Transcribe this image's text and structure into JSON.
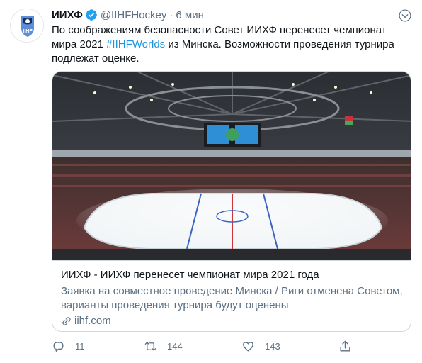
{
  "account": {
    "name": "ИИХФ",
    "handle": "@IIHFHockey",
    "separator": "·",
    "time": "6 мин",
    "logo_text": "IIHF"
  },
  "tweet": {
    "text_part1": "По соображениям безопасности Совет ИИХФ перенесет чемпионат мира 2021 ",
    "hashtag": "#IIHFWorlds",
    "text_part2": " из Минска. Возможности проведения турнира подлежат оценке."
  },
  "card": {
    "title": "ИИХФ - ИИХФ перенесет чемпионат мира 2021 года",
    "description": "Заявка на совместное проведение Минска / Риги отменена Советом, варианты проведения турнира будут оценены",
    "domain": "iihf.com"
  },
  "actions": {
    "replies": "11",
    "retweets": "144",
    "likes": "143"
  },
  "icons": {
    "verified": "verified-badge-icon",
    "caret": "chevron-down-icon",
    "reply": "reply-icon",
    "retweet": "retweet-icon",
    "like": "heart-icon",
    "share": "share-icon",
    "link": "link-icon"
  },
  "colors": {
    "link_blue": "#1b95e0",
    "verified_blue": "#1da1f2",
    "secondary_text": "#5b7083",
    "border": "#cfd9de",
    "logo_navy": "#14305f",
    "logo_blue": "#5b8ed6"
  }
}
